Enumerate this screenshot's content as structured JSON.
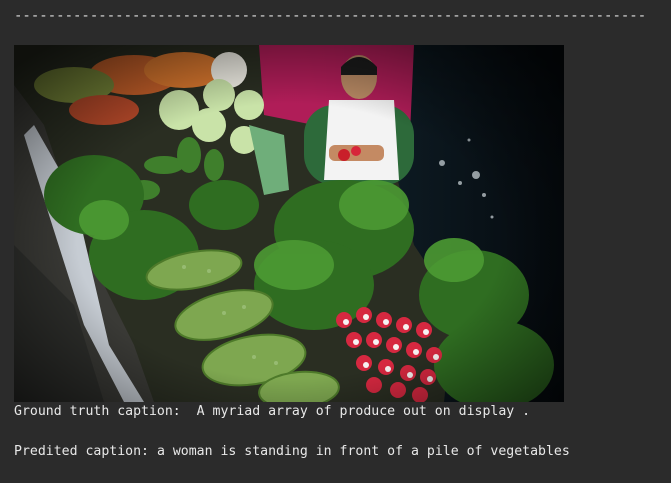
{
  "output": {
    "divider": "------------------------------------------------------------------------------------------",
    "ground_truth_label": "Ground truth caption:",
    "ground_truth_text": "A myriad array of produce out on display .",
    "predicted_label": "Predited caption:",
    "predicted_text": "a woman is standing in front of a pile of vegetables"
  },
  "colors": {
    "background": "#2b2b2b",
    "text": "#e8e8e8"
  }
}
